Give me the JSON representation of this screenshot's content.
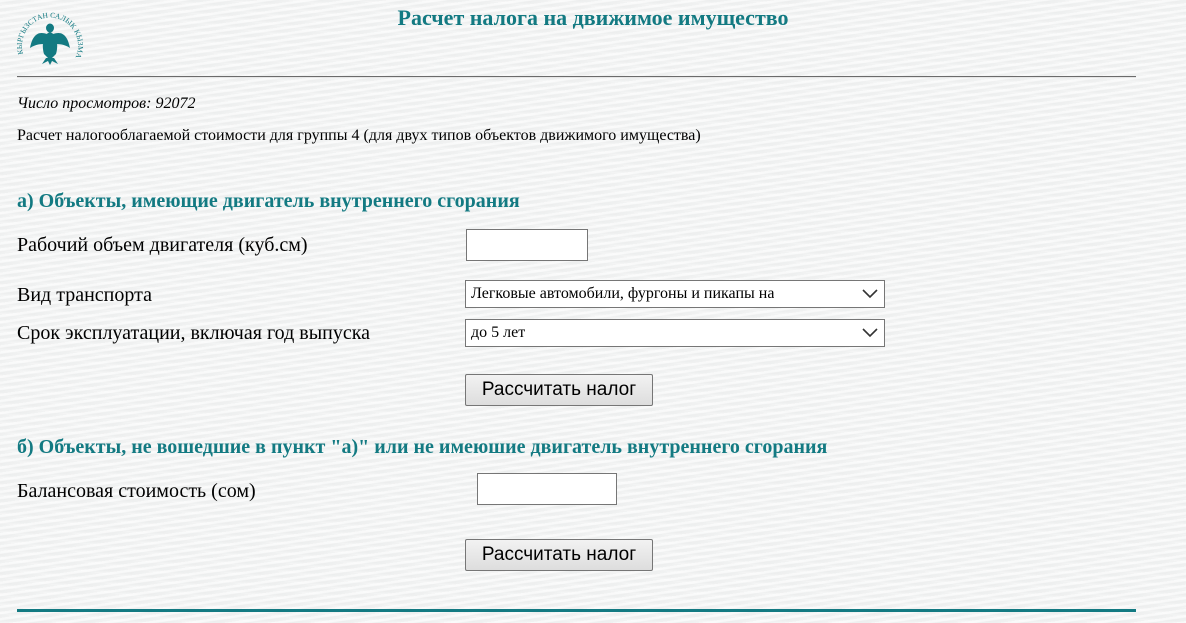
{
  "logo": {
    "emblem_text": "КЫРГЫЗСТАН САЛЫК КЫЗМАТЫ",
    "colors": {
      "primary": "#137a82"
    }
  },
  "page": {
    "title": "Расчет налога на движимое имущество",
    "views_counter": "Число просмотров: 92072",
    "intro": "Расчет налогооблагаемой стоимости для группы 4 (для двух типов объектов движимого имущества)"
  },
  "section_a": {
    "heading": "а) Объекты, имеющие двигатель внутреннего сгорания",
    "engine_volume_label": "Рабочий объем двигателя (куб.см)",
    "engine_volume_value": "",
    "vehicle_type_label": "Вид транспорта",
    "vehicle_type_value": "Легковые автомобили, фургоны и пикапы на",
    "age_label": "Срок эксплуатации, включая год выпуска",
    "age_value": "до 5 лет",
    "calc_button": "Рассчитать налог"
  },
  "section_b": {
    "heading": "б) Объекты, не вошедшие в пункт \"а)\" или не имеюшие двигатель внутреннего сгорания",
    "balance_label": "Балансовая стоимость (сом)",
    "balance_value": "",
    "calc_button": "Рассчитать налог"
  },
  "icons": {
    "logo": "eagle-emblem-icon",
    "select_arrow": "chevron-down-icon"
  },
  "colors": {
    "accent": "#137a82",
    "text": "#000000",
    "background": "#f3f4f4"
  }
}
